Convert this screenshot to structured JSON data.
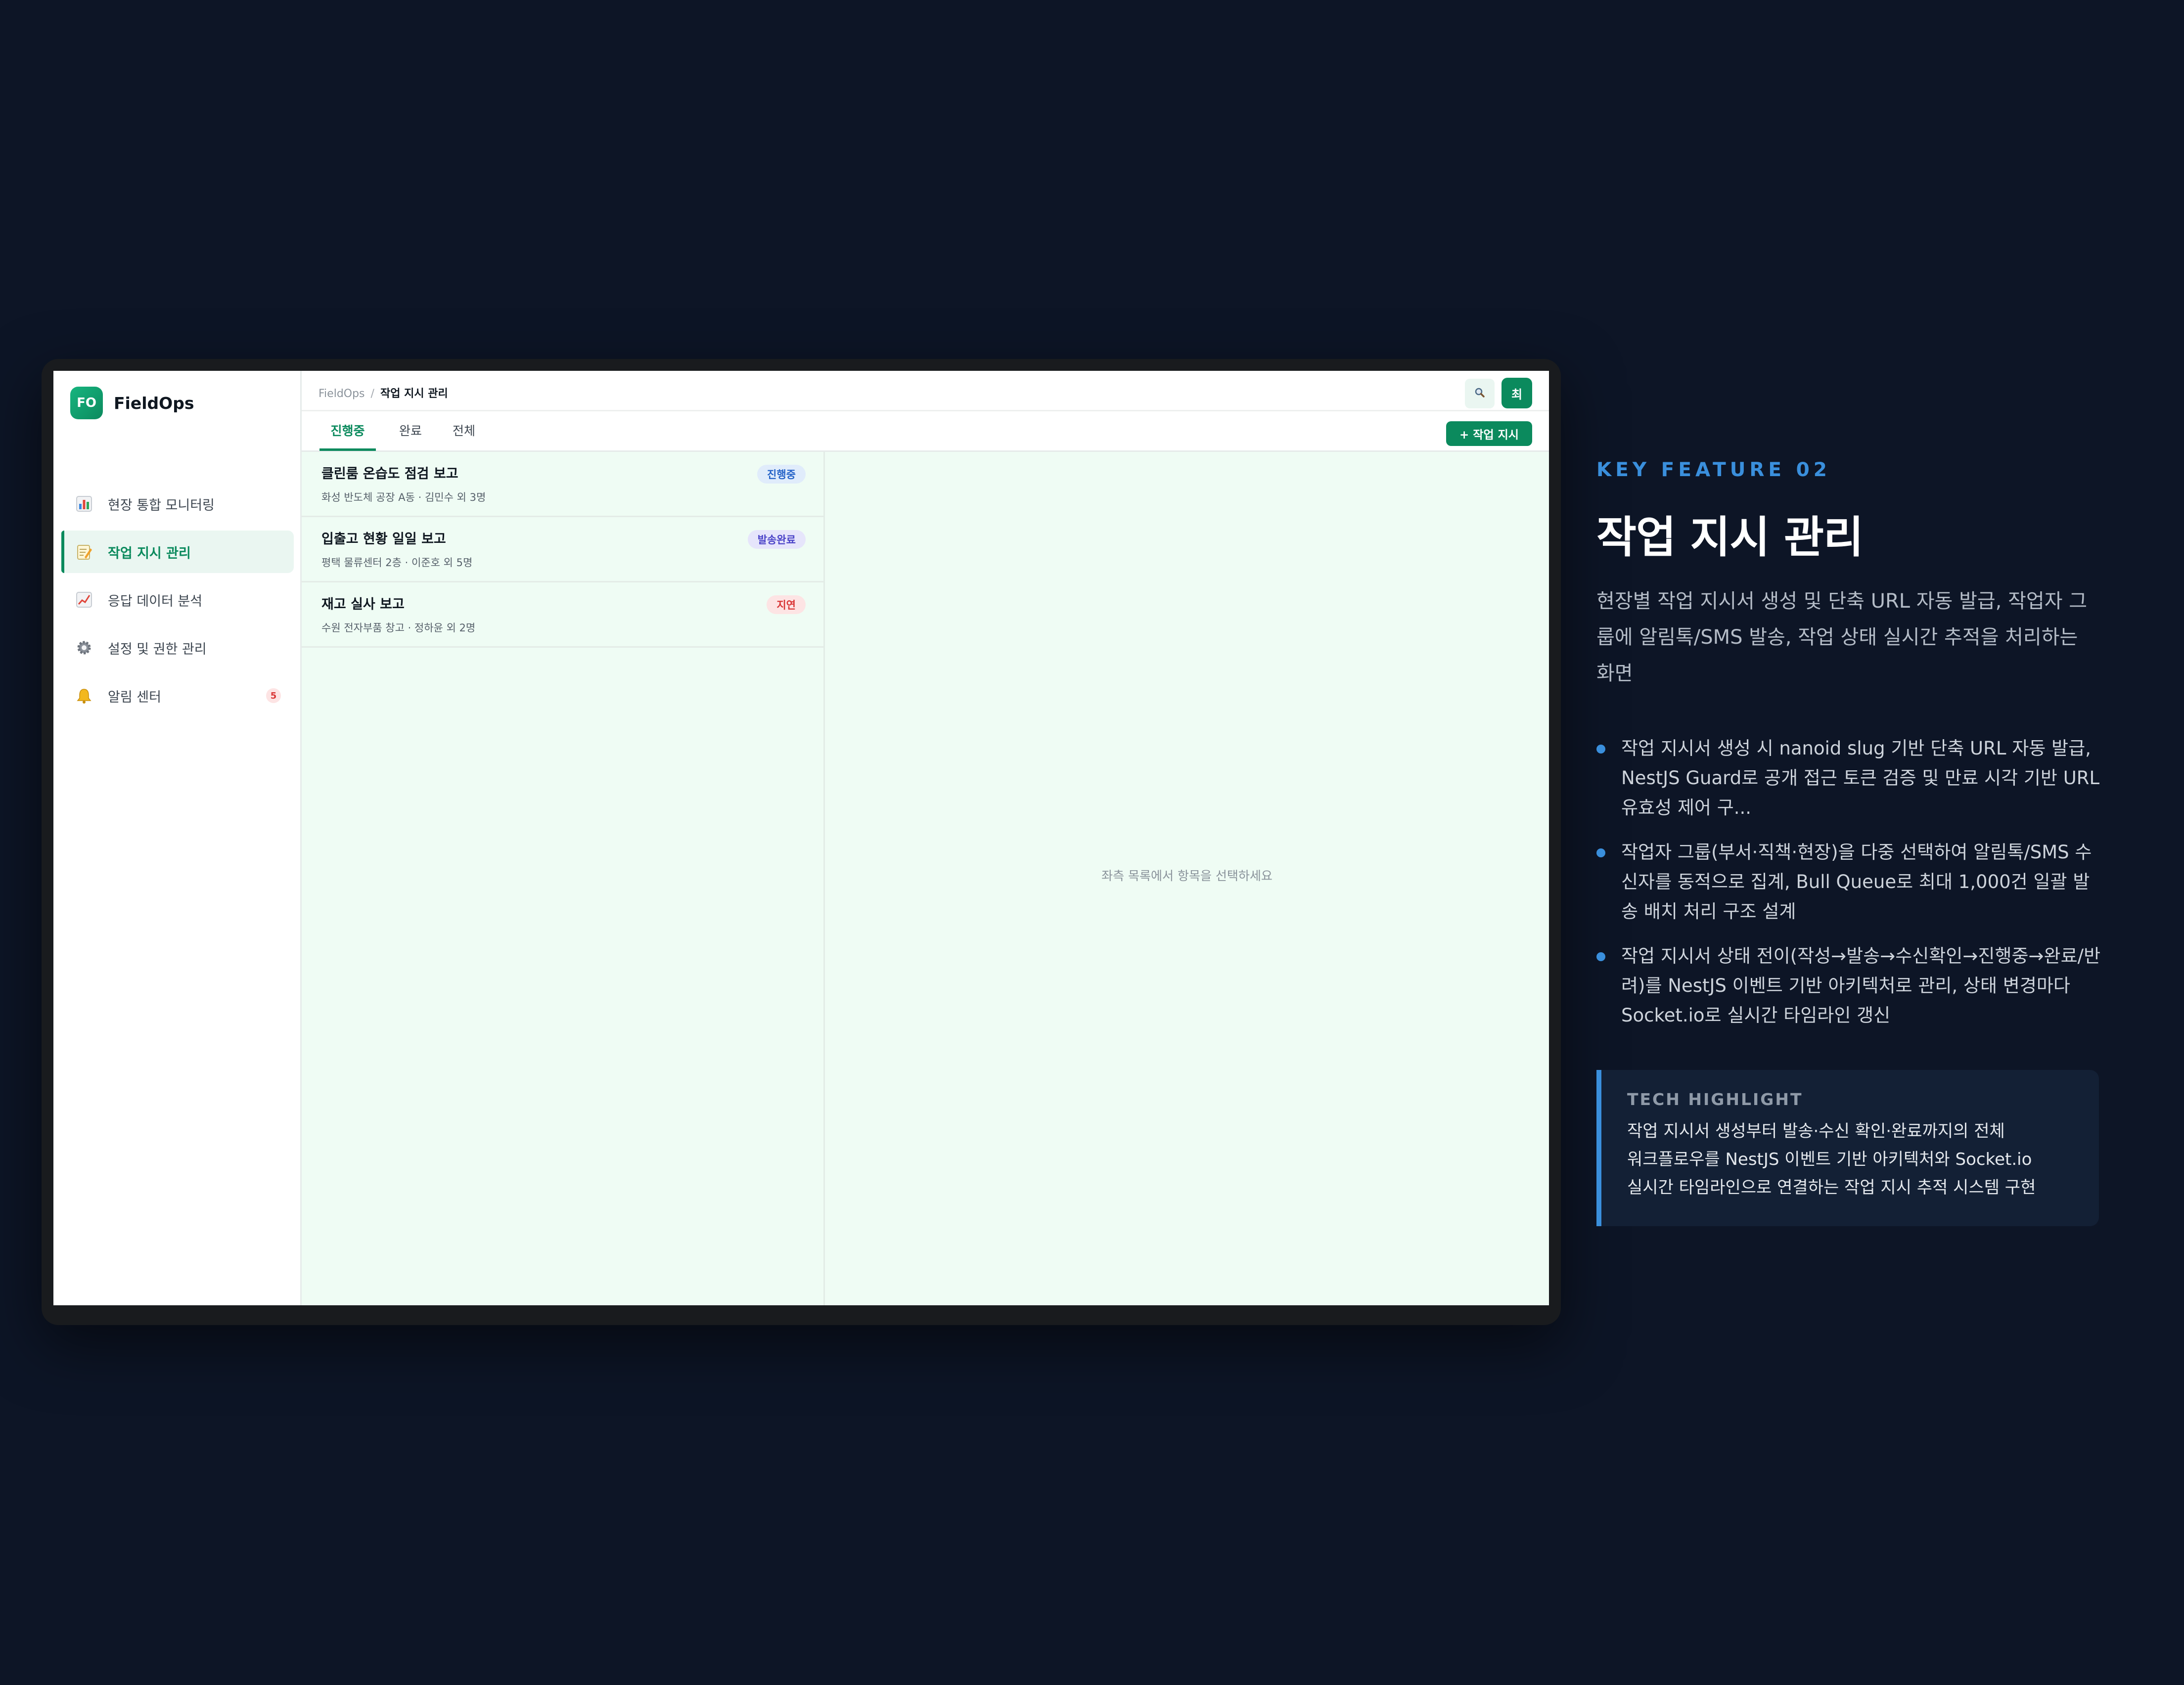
{
  "app": {
    "logo_text": "FO",
    "name": "FieldOps",
    "accent_color": "#0b8a5d"
  },
  "sidebar": {
    "items": [
      {
        "label": "현장 통합 모니터링",
        "icon": "bar-chart-icon",
        "active": false
      },
      {
        "label": "작업 지시 관리",
        "icon": "memo-icon",
        "active": true
      },
      {
        "label": "응답 데이터 분석",
        "icon": "line-chart-icon",
        "active": false
      },
      {
        "label": "설정 및 권한 관리",
        "icon": "gear-icon",
        "active": false
      },
      {
        "label": "알림 센터",
        "icon": "bell-icon",
        "active": false,
        "badge": "5"
      }
    ]
  },
  "header": {
    "breadcrumb_root": "FieldOps",
    "breadcrumb_separator": "/",
    "breadcrumb_current": "작업 지시 관리",
    "search_icon": "search-icon",
    "avatar_initial": "최"
  },
  "tabs": [
    {
      "label": "진행중",
      "active": true
    },
    {
      "label": "완료",
      "active": false
    },
    {
      "label": "전체",
      "active": false
    }
  ],
  "toolbar": {
    "new_label": "+ 작업 지시"
  },
  "orders": [
    {
      "title": "클린룸 온습도 점검 보고",
      "subtitle": "화성 반도체 공장 A동 · 김민수 외 3명",
      "status": "진행중",
      "status_bg": "#e0ecfb",
      "status_fg": "#2563c8"
    },
    {
      "title": "입출고 현황 일일 보고",
      "subtitle": "평택 물류센터 2층 · 이준호 외 5명",
      "status": "발송완료",
      "status_bg": "#e6e5fb",
      "status_fg": "#4b44c8"
    },
    {
      "title": "재고 실사 보고",
      "subtitle": "수원 전자부품 창고 · 정하윤 외 2명",
      "status": "지연",
      "status_bg": "#fde4e4",
      "status_fg": "#d93636"
    }
  ],
  "detail": {
    "empty_message": "좌측 목록에서 항목을 선택하세요"
  },
  "feature": {
    "kicker": "KEY FEATURE 02",
    "title": "작업 지시 관리",
    "description": "현장별 작업 지시서 생성 및 단축 URL 자동 발급, 작업자 그룹에 알림톡/SMS 발송, 작업 상태 실시간 추적을 처리하는 화면",
    "bullets": [
      "작업 지시서 생성 시 nanoid slug 기반 단축 URL 자동 발급, NestJS Guard로 공개 접근 토큰 검증 및 만료 시각 기반 URL 유효성 제어 구...",
      "작업자 그룹(부서·직책·현장)을 다중 선택하여 알림톡/SMS 수신자를 동적으로 집계, Bull Queue로 최대 1,000건 일괄 발송 배치 처리 구조 설계",
      "작업 지시서 상태 전이(작성→발송→수신확인→진행중→완료/반려)를 NestJS 이벤트 기반 아키텍처로 관리, 상태 변경마다 Socket.io로 실시간 타임라인 갱신"
    ],
    "highlight_title": "TECH HIGHLIGHT",
    "highlight_lines": [
      "작업 지시서 생성부터 발송·수신 확인·완료까지의 전체",
      "워크플로우를 NestJS 이벤트 기반 아키텍처와 Socket.io",
      "실시간 타임라인으로 연결하는 작업 지시 추적 시스템 구현"
    ],
    "accent_color": "#3a8fdc"
  }
}
